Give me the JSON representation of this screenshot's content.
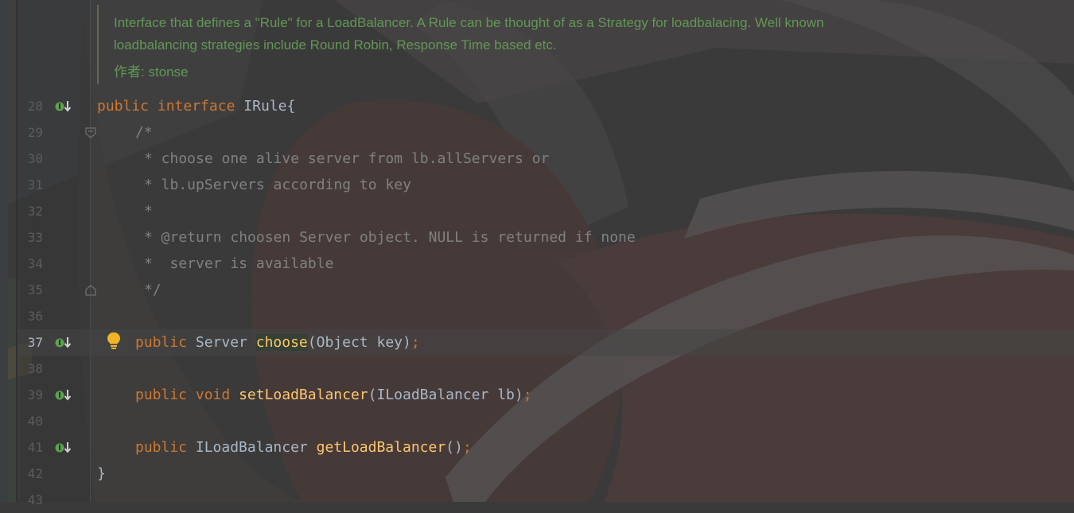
{
  "javadoc": {
    "description": "Interface that defines a \"Rule\" for a LoadBalancer. A Rule can be thought of as a Strategy for loadbalacing. Well known loadbalancing strategies include Round Robin, Response Time based etc.",
    "author_label": "作者:",
    "author_value": "stonse"
  },
  "editor": {
    "current_line": "37",
    "lines": [
      {
        "number": "28",
        "tokens": [
          "public",
          "interface",
          "IRule{"
        ]
      },
      {
        "number": "29",
        "tokens": [
          "/*"
        ]
      },
      {
        "number": "30",
        "tokens": [
          "* choose one alive server from lb.allServers or"
        ]
      },
      {
        "number": "31",
        "tokens": [
          "* lb.upServers according to key"
        ]
      },
      {
        "number": "32",
        "tokens": [
          "*"
        ]
      },
      {
        "number": "33",
        "tokens": [
          "* @return choosen Server object. NULL is returned if none"
        ]
      },
      {
        "number": "34",
        "tokens": [
          "*  server is available"
        ]
      },
      {
        "number": "35",
        "tokens": [
          "*/"
        ]
      },
      {
        "number": "36",
        "tokens": []
      },
      {
        "number": "37",
        "tokens": [
          "public",
          "Server",
          "choose",
          "(Object key)",
          ";"
        ]
      },
      {
        "number": "38",
        "tokens": []
      },
      {
        "number": "39",
        "tokens": [
          "public",
          "void",
          "setLoadBalancer",
          "(ILoadBalancer lb)",
          ";"
        ]
      },
      {
        "number": "40",
        "tokens": []
      },
      {
        "number": "41",
        "tokens": [
          "public",
          "ILoadBalancer",
          "getLoadBalancer",
          "()",
          ";"
        ]
      },
      {
        "number": "42",
        "tokens": [
          "}"
        ]
      },
      {
        "number": "43",
        "tokens": []
      }
    ]
  },
  "icons": {
    "implemented": "implemented-method-icon",
    "fold": "fold-marker-icon",
    "intention": "lightbulb-icon"
  },
  "colors": {
    "keyword": "#cc7832",
    "comment": "#808080",
    "method": "#ffc66d",
    "plain": "#a9b7c6",
    "doc": "#629755",
    "line_number": "#5c5c5c",
    "implemented_icon": "#5fa052",
    "bulb": "#f0b429"
  }
}
